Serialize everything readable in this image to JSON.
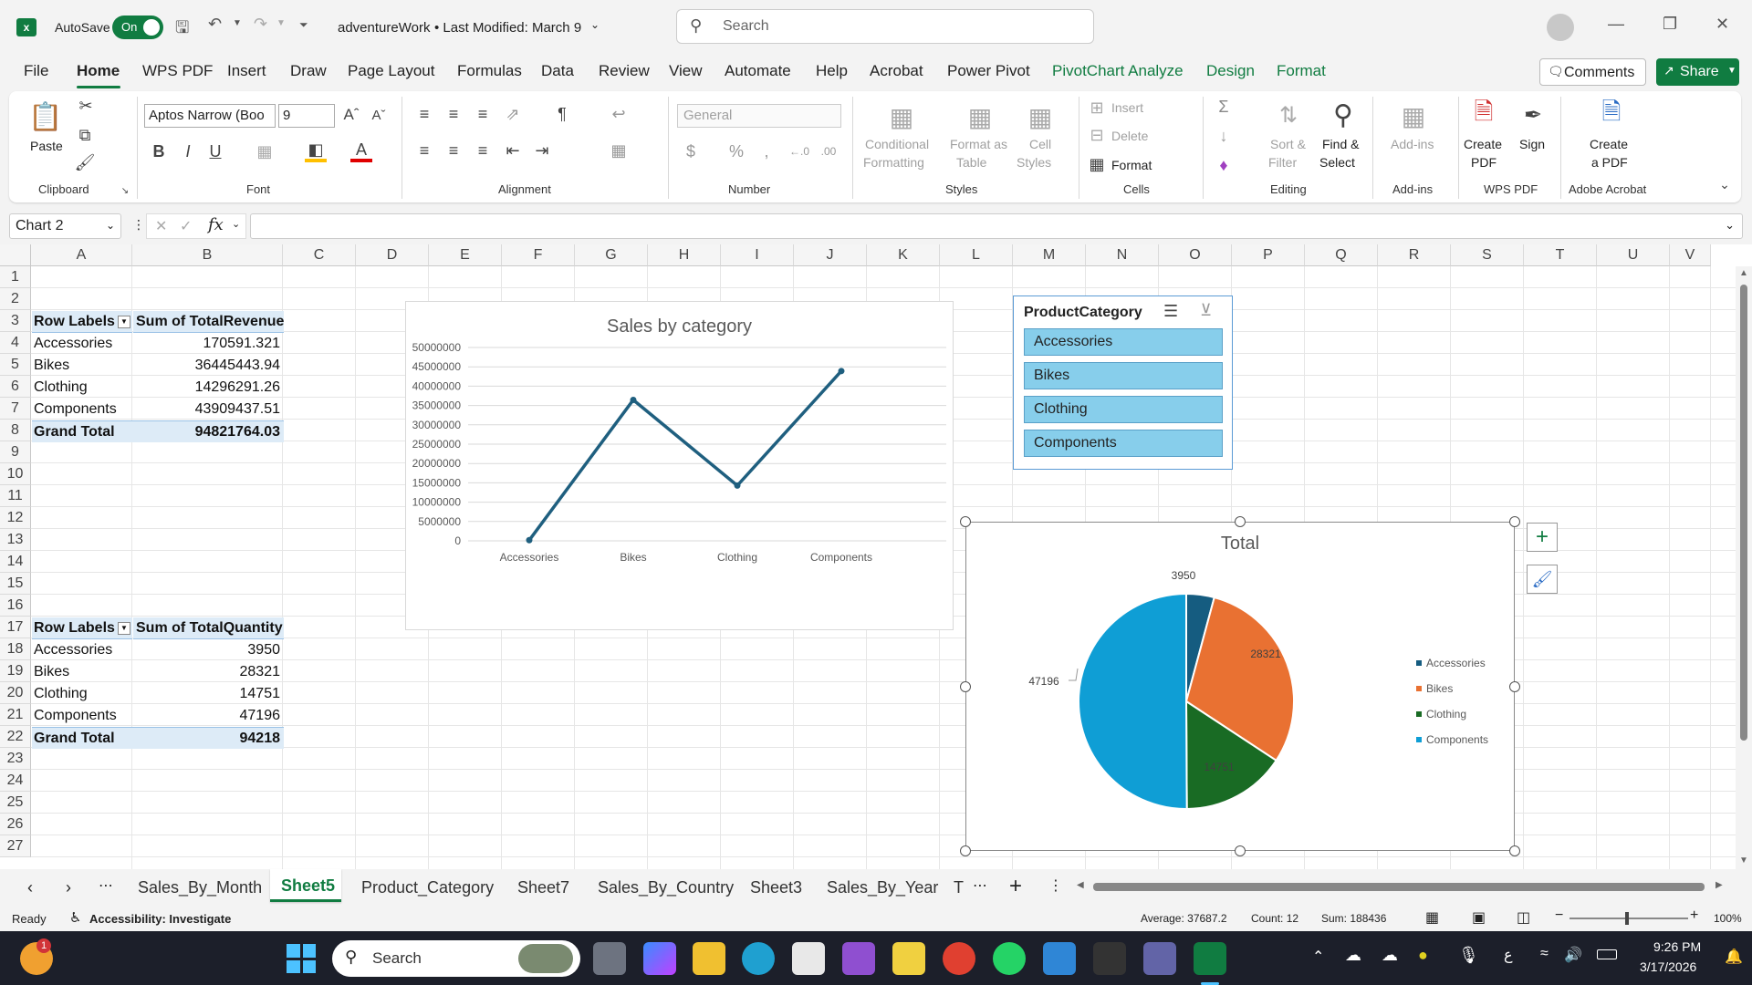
{
  "titlebar": {
    "autosave_label": "AutoSave",
    "autosave_state": "On",
    "filename": "adventureWork",
    "modified": "•  Last Modified: March 9",
    "search_placeholder": "Search"
  },
  "tabs": [
    "File",
    "Home",
    "WPS PDF",
    "Insert",
    "Draw",
    "Page Layout",
    "Formulas",
    "Data",
    "Review",
    "View",
    "Automate",
    "Help",
    "Acrobat",
    "Power Pivot",
    "PivotChart Analyze",
    "Design",
    "Format"
  ],
  "actions": {
    "comments": "Comments",
    "share": "Share"
  },
  "ribbon": {
    "clipboard": {
      "paste": "Paste",
      "label": "Clipboard"
    },
    "font": {
      "name": "Aptos Narrow (Boo",
      "size": "9",
      "label": "Font"
    },
    "alignment": {
      "label": "Alignment"
    },
    "number": {
      "format": "General",
      "label": "Number"
    },
    "styles": {
      "conditional": "Conditional",
      "formatting": "Formatting",
      "format_as": "Format as",
      "table": "Table",
      "cell": "Cell",
      "styles": "Styles",
      "label": "Styles"
    },
    "cells": {
      "insert": "Insert",
      "delete": "Delete",
      "format": "Format",
      "label": "Cells"
    },
    "editing": {
      "sort": "Sort &",
      "filter": "Filter",
      "find": "Find &",
      "select": "Select",
      "label": "Editing"
    },
    "addins": {
      "addins": "Add-ins",
      "label": "Add-ins"
    },
    "wps": {
      "create": "Create",
      "pdf": "PDF",
      "sign": "Sign",
      "label": "WPS PDF"
    },
    "acrobat": {
      "create": "Create",
      "apdf": "a PDF",
      "label": "Adobe Acrobat"
    }
  },
  "formula_bar": {
    "name_box": "Chart 2",
    "value": ""
  },
  "columns": [
    "A",
    "B",
    "C",
    "D",
    "E",
    "F",
    "G",
    "H",
    "I",
    "J",
    "K",
    "L",
    "M",
    "N",
    "O",
    "P",
    "Q",
    "R",
    "S",
    "T",
    "U",
    "V"
  ],
  "rows": [
    "1",
    "2",
    "3",
    "4",
    "5",
    "6",
    "7",
    "8",
    "9",
    "10",
    "11",
    "12",
    "13",
    "14",
    "15",
    "16",
    "17",
    "18",
    "19",
    "20",
    "21",
    "22",
    "23",
    "24",
    "25",
    "26",
    "27"
  ],
  "pivot1": {
    "header": [
      "Row Labels",
      "Sum of TotalRevenue"
    ],
    "rows": [
      [
        "Accessories",
        "170591.321"
      ],
      [
        "Bikes",
        "36445443.94"
      ],
      [
        "Clothing",
        "14296291.26"
      ],
      [
        "Components",
        "43909437.51"
      ]
    ],
    "total": [
      "Grand Total",
      "94821764.03"
    ]
  },
  "pivot2": {
    "header": [
      "Row Labels",
      "Sum of TotalQuantity"
    ],
    "rows": [
      [
        "Accessories",
        "3950"
      ],
      [
        "Bikes",
        "28321"
      ],
      [
        "Clothing",
        "14751"
      ],
      [
        "Components",
        "47196"
      ]
    ],
    "total": [
      "Grand Total",
      "94218"
    ]
  },
  "slicer": {
    "title": "ProductCategory",
    "items": [
      "Accessories",
      "Bikes",
      "Clothing",
      "Components"
    ]
  },
  "chart_data": [
    {
      "type": "line",
      "title": "Sales by category",
      "categories": [
        "Accessories",
        "Bikes",
        "Clothing",
        "Components"
      ],
      "values": [
        170591.321,
        36445443.94,
        14296291.26,
        43909437.51
      ],
      "yticks": [
        "0",
        "5000000",
        "10000000",
        "15000000",
        "20000000",
        "25000000",
        "30000000",
        "35000000",
        "40000000",
        "45000000",
        "50000000"
      ],
      "ylim": [
        0,
        50000000
      ],
      "grid": true,
      "color": "#1f5f7f"
    },
    {
      "type": "pie",
      "title": "Total",
      "categories": [
        "Accessories",
        "Bikes",
        "Clothing",
        "Components"
      ],
      "values": [
        3950,
        28321,
        14751,
        47196
      ],
      "labels": [
        "3950",
        "28321",
        "14751",
        "47196"
      ],
      "colors": [
        "#155c80",
        "#e97132",
        "#196b24",
        "#0f9ed5"
      ],
      "legend": "right"
    }
  ],
  "sheets": [
    "Sales_By_Month",
    "Sheet5",
    "Product_Category",
    "Sheet7",
    "Sales_By_Country",
    "Sheet3",
    "Sales_By_Year",
    "T"
  ],
  "active_sheet": "Sheet5",
  "status": {
    "ready": "Ready",
    "accessibility": "Accessibility: Investigate",
    "average": "Average: 37687.2",
    "count": "Count: 12",
    "sum": "Sum: 188436",
    "zoom": "100%"
  },
  "taskbar": {
    "search": "Search",
    "time": "9:26 PM",
    "date": "3/17/2026",
    "badge": "1"
  }
}
